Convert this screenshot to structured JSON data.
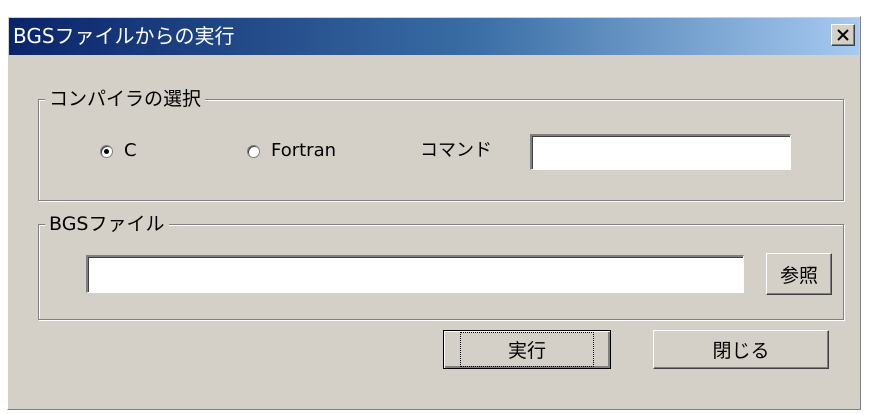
{
  "window": {
    "title": "BGSファイルからの実行",
    "close_glyph": "×"
  },
  "compiler_group": {
    "legend": "コンパイラの選択",
    "options": [
      {
        "label": "C",
        "checked": true
      },
      {
        "label": "Fortran",
        "checked": false
      }
    ],
    "command_label": "コマンド",
    "command_value": ""
  },
  "file_group": {
    "legend": "BGSファイル",
    "path_value": "",
    "browse_label": "参照"
  },
  "buttons": {
    "run_label": "実行",
    "close_label": "閉じる"
  },
  "colors": {
    "face": "#d4d0c8",
    "title_start": "#0a246a",
    "title_end": "#a6caf0"
  }
}
